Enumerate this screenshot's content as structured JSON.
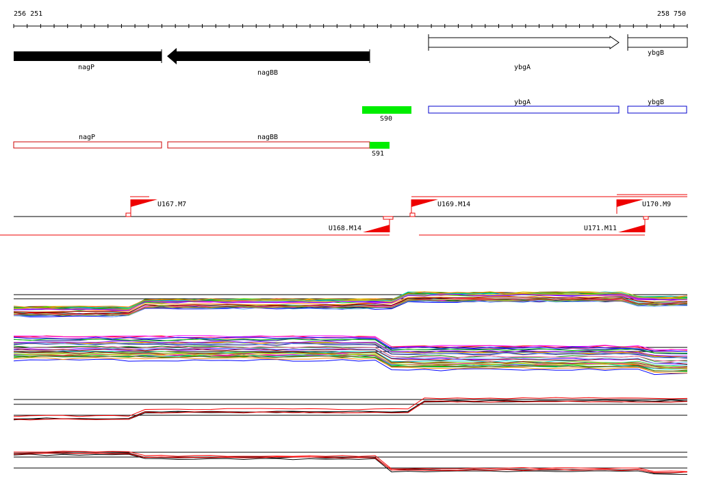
{
  "ruler": {
    "start_label": "256 251",
    "end_label": "258 750"
  },
  "genes": [
    {
      "name": "nagP",
      "strand": "-",
      "style": "filled"
    },
    {
      "name": "nagBB",
      "strand": "-",
      "style": "filled"
    },
    {
      "name": "ybgA",
      "strand": "+",
      "style": "outline"
    },
    {
      "name": "ybgB",
      "strand": "+",
      "style": "outline"
    }
  ],
  "transcripts_top": [
    {
      "name": "S90",
      "color": "#00ee00",
      "kind": "green"
    },
    {
      "name": "ybgA",
      "color": "#0000cc",
      "kind": "blue"
    },
    {
      "name": "ybgB",
      "color": "#0000cc",
      "kind": "blue"
    }
  ],
  "transcripts_bottom": [
    {
      "name": "nagP",
      "color": "#cc0000",
      "kind": "red"
    },
    {
      "name": "nagBB",
      "color": "#cc0000",
      "kind": "red"
    },
    {
      "name": "S91",
      "color": "#00ee00",
      "kind": "green"
    }
  ],
  "promoters": [
    {
      "name": "U167.M7",
      "strand": "+"
    },
    {
      "name": "U168.M14",
      "strand": "-"
    },
    {
      "name": "U169.M14",
      "strand": "+"
    },
    {
      "name": "U170.M9",
      "strand": "+"
    },
    {
      "name": "U171.M11",
      "strand": "-"
    }
  ],
  "colors": {
    "gene_fill": "#000000",
    "promoter_flag": "#ee0000",
    "green_block": "#00ee00",
    "blue_outline": "#0000cc",
    "red_outline": "#cc0000"
  }
}
